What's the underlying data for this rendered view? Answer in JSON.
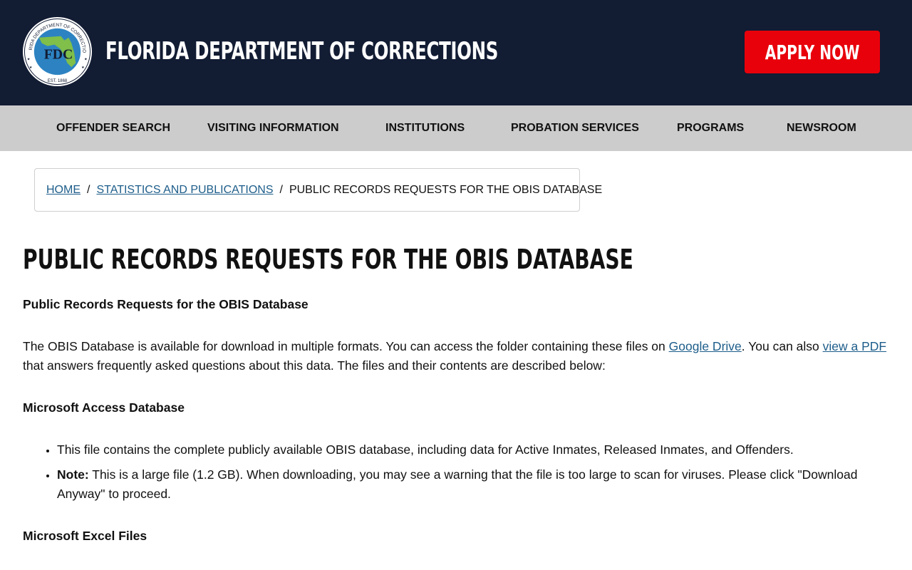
{
  "header": {
    "logo_text": {
      "ring": "FLORIDA DEPARTMENT OF CORRECTIONS",
      "initials": "FDC",
      "est": "EST. 1868"
    },
    "site_title": "FLORIDA DEPARTMENT OF CORRECTIONS",
    "apply_label": "APPLY NOW"
  },
  "nav": {
    "items": [
      {
        "label": "OFFENDER SEARCH"
      },
      {
        "label": "VISITING INFORMATION"
      },
      {
        "label": "INSTITUTIONS"
      },
      {
        "label": "PROBATION SERVICES"
      },
      {
        "label": "PROGRAMS"
      },
      {
        "label": "NEWSROOM"
      }
    ]
  },
  "breadcrumb": {
    "home": "HOME",
    "parent": "STATISTICS AND PUBLICATIONS",
    "current": "PUBLIC RECORDS REQUESTS FOR THE OBIS DATABASE",
    "separator": "/"
  },
  "page": {
    "title": "PUBLIC RECORDS REQUESTS FOR THE OBIS DATABASE",
    "subtitle": "Public Records Requests for the OBIS Database",
    "intro": {
      "text1": "The OBIS Database is available for download in multiple formats. You can access the folder containing these files on ",
      "link1": "Google Drive",
      "text2": ". You can also ",
      "link2": "view a PDF",
      "text3": " that answers frequently asked questions about this data. The files and their contents are described below:"
    },
    "access_heading": "Microsoft Access Database",
    "access_items": {
      "item1": "This file contains the complete publicly available OBIS database, including data for Active Inmates, Released Inmates, and Offenders.",
      "note_label": "Note:",
      "note_text": " This is a large file (1.2 GB). When downloading, you may see a warning that the file is too large to scan for viruses. Please click \"Download Anyway\" to proceed."
    },
    "excel_heading": "Microsoft Excel Files"
  },
  "colors": {
    "header_bg": "#121c33",
    "apply_bg": "#e8000b",
    "nav_bg": "#cccccc",
    "link": "#1d5d8a"
  }
}
